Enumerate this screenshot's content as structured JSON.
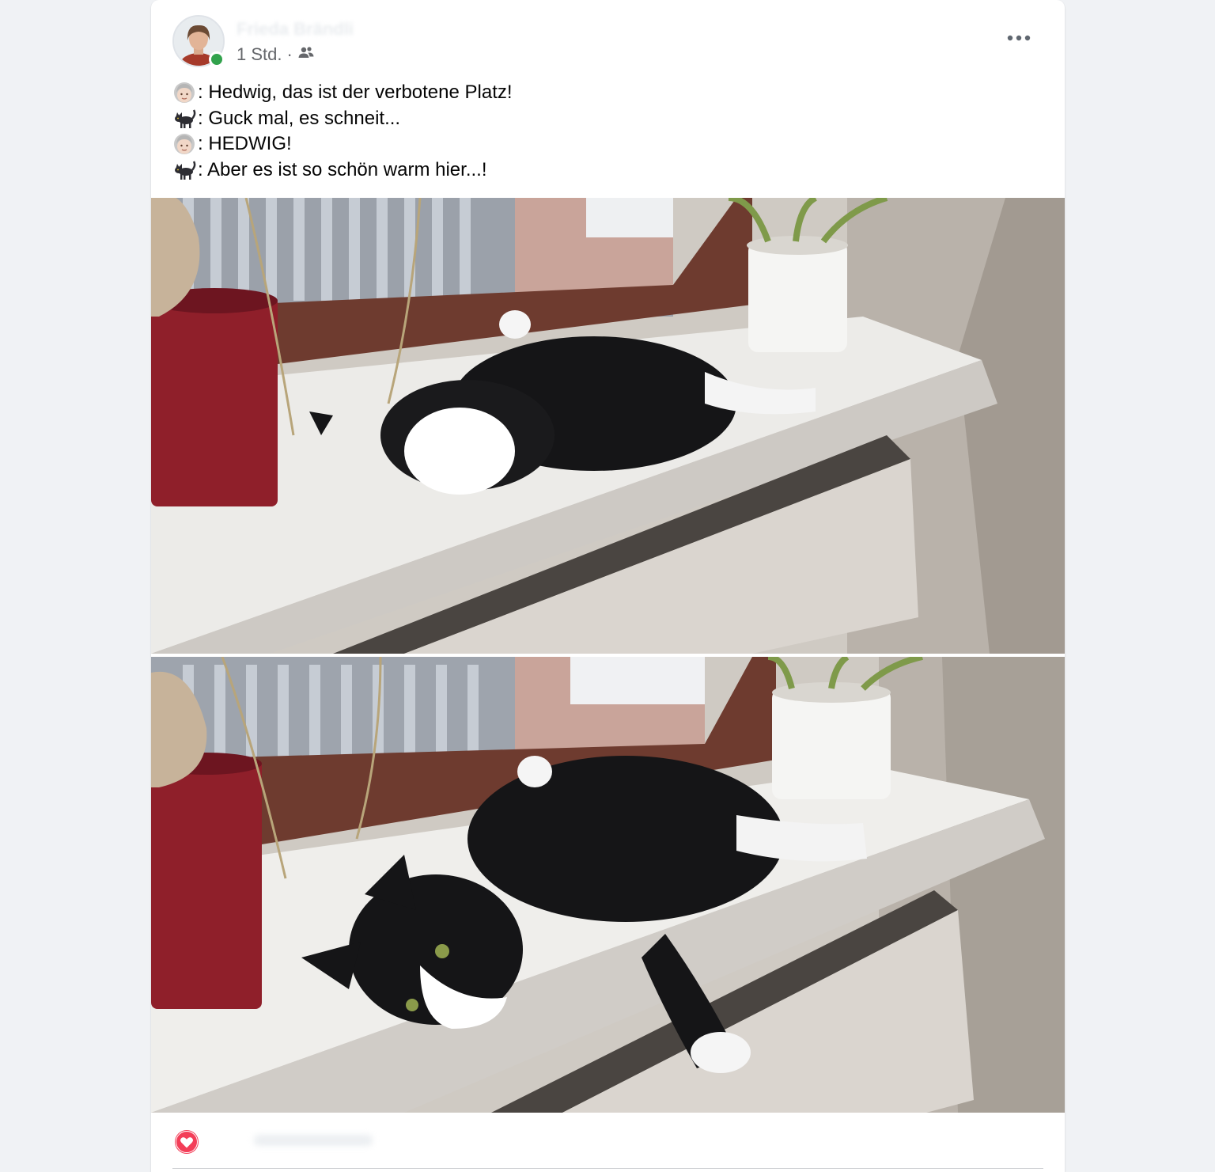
{
  "post": {
    "author": "Frieda Brändli",
    "timestamp": "1 Std.",
    "separator": "·",
    "audience_icon": "friends-icon",
    "more_icon": "more-options-icon",
    "lines": [
      {
        "emoji": "old-woman-emoji",
        "text": ": Hedwig, das ist der verbotene Platz!"
      },
      {
        "emoji": "black-cat-emoji",
        "text": ": Guck mal, es schneit..."
      },
      {
        "emoji": "old-woman-emoji",
        "text": ": HEDWIG!"
      },
      {
        "emoji": "black-cat-emoji",
        "text": ": Aber es ist so schön warm hier...!"
      }
    ],
    "photos": [
      {
        "name": "cat-rolling-on-windowsill-photo"
      },
      {
        "name": "cat-lying-on-windowsill-photo"
      }
    ],
    "reaction_icon": "love-reaction-icon"
  },
  "colors": {
    "online": "#31a24c",
    "love": "#f33e58",
    "meta_text": "#65676b"
  }
}
